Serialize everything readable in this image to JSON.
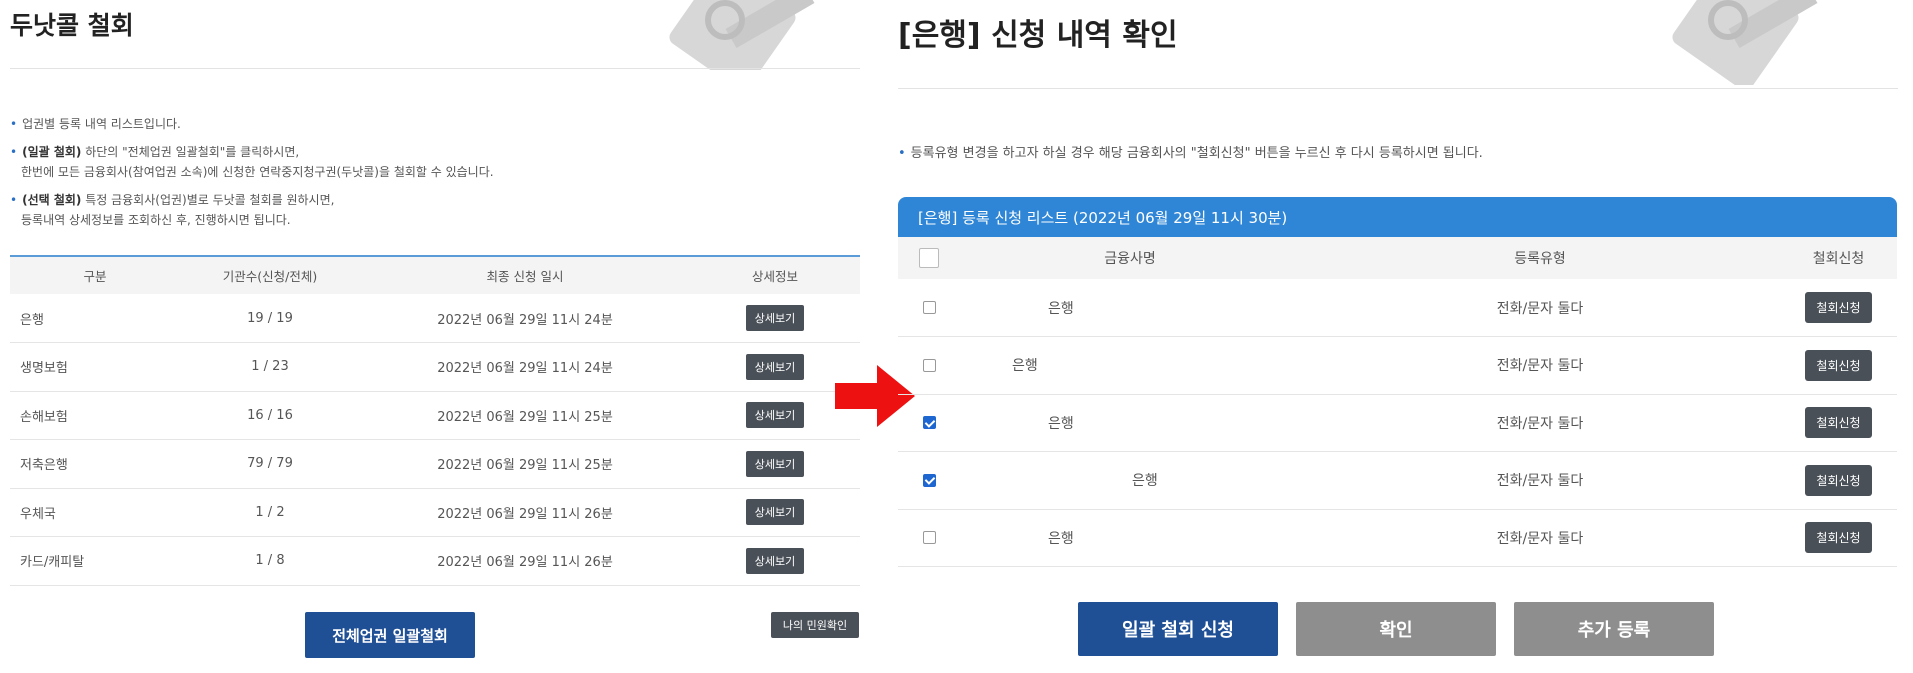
{
  "left": {
    "title": "두낫콜 철회",
    "notes": [
      {
        "bold": "",
        "text": "업권별 등록 내역 리스트입니다."
      },
      {
        "bold": "(일괄 철회)",
        "text": " 하단의 \"전체업권 일괄철회\"를 클릭하시면,",
        "text2": "한번에 모든 금융회사(참여업권 소속)에 신청한 연락중지청구권(두낫콜)을 철회할 수 있습니다."
      },
      {
        "bold": "(선택 철회)",
        "text": " 특정 금융회사(업권)별로 두낫콜 철회를 원하시면,",
        "text2": "등록내역 상세정보를 조회하신 후, 진행하시면 됩니다."
      }
    ],
    "table": {
      "headers": [
        "구분",
        "기관수(신청/전체)",
        "최종 신청 일시",
        "상세정보"
      ],
      "rows": [
        {
          "category": "은행",
          "count": "19 / 19",
          "date": "2022년 06월 29일 11시 24분",
          "button": "상세보기"
        },
        {
          "category": "생명보험",
          "count": "1 / 23",
          "date": "2022년 06월 29일 11시 24분",
          "button": "상세보기"
        },
        {
          "category": "손해보험",
          "count": "16 / 16",
          "date": "2022년 06월 29일 11시 25분",
          "button": "상세보기"
        },
        {
          "category": "저축은행",
          "count": "79 / 79",
          "date": "2022년 06월 29일 11시 25분",
          "button": "상세보기"
        },
        {
          "category": "우체국",
          "count": "1 / 2",
          "date": "2022년 06월 29일 11시 26분",
          "button": "상세보기"
        },
        {
          "category": "카드/캐피탈",
          "count": "1 / 8",
          "date": "2022년 06월 29일 11시 26분",
          "button": "상세보기"
        }
      ]
    },
    "bulk_button": "전체업권 일괄철회",
    "my_button": "나의 민원확인"
  },
  "arrow_color": "#ee1111",
  "right": {
    "title": "[은행] 신청 내역 확인",
    "note": "등록유형 변경을 하고자 하실 경우 해당 금융회사의 \"철회신청\" 버튼을 누르신 후 다시 등록하시면 됩니다.",
    "list_header": "[은행] 등록 신청 리스트 (2022년 06월 29일 11시 30분)",
    "headers": [
      "금융사명",
      "등록유형",
      "철회신청"
    ],
    "rows": [
      {
        "checked": false,
        "name": "은행",
        "type": "전화/문자 둘다",
        "button": "철회신청"
      },
      {
        "checked": false,
        "name": "은행",
        "type": "전화/문자 둘다",
        "button": "철회신청"
      },
      {
        "checked": true,
        "name": "은행",
        "type": "전화/문자 둘다",
        "button": "철회신청"
      },
      {
        "checked": true,
        "name": "은행",
        "type": "전화/문자 둘다",
        "button": "철회신청"
      },
      {
        "checked": false,
        "name": "은행",
        "type": "전화/문자 둘다",
        "button": "철회신청"
      }
    ],
    "buttons": {
      "bulk": "일괄 철회 신청",
      "confirm": "확인",
      "add": "추가 등록"
    }
  }
}
